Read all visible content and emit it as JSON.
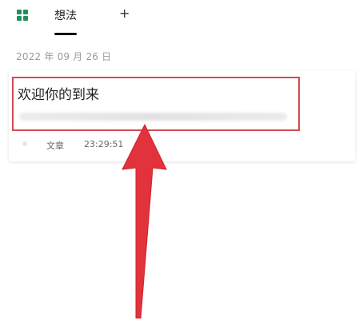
{
  "header": {
    "grid_icon": "grid-icon",
    "active_tab_label": "想法",
    "add_tab_label": "+"
  },
  "main": {
    "date_label": "2022 年 09 月 26 日",
    "card": {
      "title": "欢迎你的到来",
      "type_label": "文章",
      "time_label": "23:29:51"
    }
  },
  "annotations": {
    "highlight_color": "#d24a52",
    "arrow_color": "#e2333c"
  }
}
